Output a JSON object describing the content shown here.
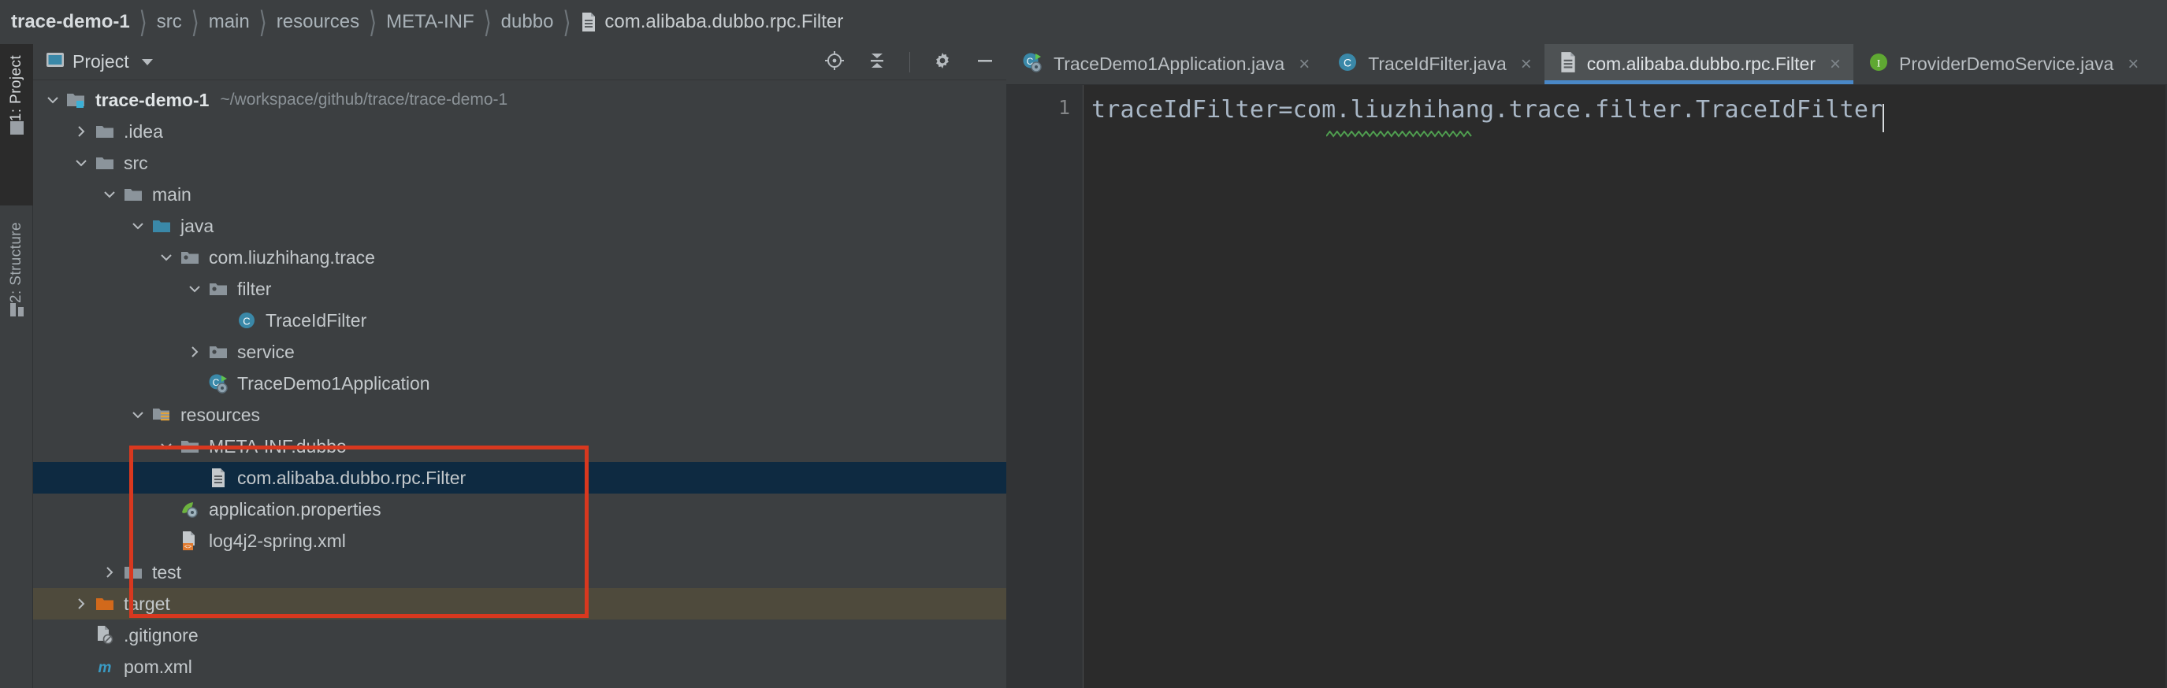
{
  "breadcrumb": {
    "items": [
      {
        "label": "trace-demo-1",
        "kind": "root"
      },
      {
        "label": "src",
        "kind": "plain"
      },
      {
        "label": "main",
        "kind": "plain"
      },
      {
        "label": "resources",
        "kind": "plain"
      },
      {
        "label": "META-INF",
        "kind": "plain"
      },
      {
        "label": "dubbo",
        "kind": "plain"
      },
      {
        "label": "com.alibaba.dubbo.rpc.Filter",
        "kind": "file",
        "icon": "text-file-icon"
      }
    ]
  },
  "tool_strip": {
    "tabs": [
      {
        "label": "1: Project",
        "icon": "project-icon",
        "active": true
      },
      {
        "label": "2: Structure",
        "icon": "structure-icon",
        "active": false
      }
    ]
  },
  "project_panel": {
    "title": "Project",
    "view_selector_icon": "chevron-down-icon",
    "tools": [
      {
        "name": "scroll-from-source-icon",
        "tooltip": "Select Opened File"
      },
      {
        "name": "collapse-all-icon",
        "tooltip": "Collapse All"
      },
      {
        "name": "settings-gear-icon",
        "tooltip": "Settings"
      },
      {
        "name": "hide-panel-icon",
        "tooltip": "Hide"
      }
    ],
    "tree": [
      {
        "label": "trace-demo-1",
        "sub": "~/workspace/github/trace/trace-demo-1",
        "depth": 0,
        "arrow": "down",
        "icon": "module-icon",
        "bold": true,
        "state": "normal"
      },
      {
        "label": ".idea",
        "sub": "",
        "depth": 1,
        "arrow": "right",
        "icon": "folder-icon",
        "bold": false,
        "state": "normal"
      },
      {
        "label": "src",
        "sub": "",
        "depth": 1,
        "arrow": "down",
        "icon": "folder-icon",
        "bold": false,
        "state": "normal"
      },
      {
        "label": "main",
        "sub": "",
        "depth": 2,
        "arrow": "down",
        "icon": "folder-icon",
        "bold": false,
        "state": "normal"
      },
      {
        "label": "java",
        "sub": "",
        "depth": 3,
        "arrow": "down",
        "icon": "source-root-icon",
        "bold": false,
        "state": "normal"
      },
      {
        "label": "com.liuzhihang.trace",
        "sub": "",
        "depth": 4,
        "arrow": "down",
        "icon": "package-icon",
        "bold": false,
        "state": "normal"
      },
      {
        "label": "filter",
        "sub": "",
        "depth": 5,
        "arrow": "down",
        "icon": "package-icon",
        "bold": false,
        "state": "normal"
      },
      {
        "label": "TraceIdFilter",
        "sub": "",
        "depth": 6,
        "arrow": "none",
        "icon": "java-class-icon",
        "bold": false,
        "state": "normal"
      },
      {
        "label": "service",
        "sub": "",
        "depth": 5,
        "arrow": "right",
        "icon": "package-icon",
        "bold": false,
        "state": "normal"
      },
      {
        "label": "TraceDemo1Application",
        "sub": "",
        "depth": 5,
        "arrow": "none",
        "icon": "spring-boot-class-icon",
        "bold": false,
        "state": "normal"
      },
      {
        "label": "resources",
        "sub": "",
        "depth": 3,
        "arrow": "down",
        "icon": "resource-root-icon",
        "bold": false,
        "state": "normal"
      },
      {
        "label": "META-INF.dubbo",
        "sub": "",
        "depth": 4,
        "arrow": "down",
        "icon": "folder-icon",
        "bold": false,
        "state": "normal"
      },
      {
        "label": "com.alibaba.dubbo.rpc.Filter",
        "sub": "",
        "depth": 5,
        "arrow": "none",
        "icon": "text-file-icon",
        "bold": false,
        "state": "selected"
      },
      {
        "label": "application.properties",
        "sub": "",
        "depth": 4,
        "arrow": "none",
        "icon": "spring-properties-icon",
        "bold": false,
        "state": "normal"
      },
      {
        "label": "log4j2-spring.xml",
        "sub": "",
        "depth": 4,
        "arrow": "none",
        "icon": "xml-file-icon",
        "bold": false,
        "state": "normal"
      },
      {
        "label": "test",
        "sub": "",
        "depth": 2,
        "arrow": "right",
        "icon": "folder-icon",
        "bold": false,
        "state": "normal"
      },
      {
        "label": "target",
        "sub": "",
        "depth": 1,
        "arrow": "right",
        "icon": "excluded-folder-icon",
        "bold": false,
        "state": "excluded"
      },
      {
        "label": ".gitignore",
        "sub": "",
        "depth": 1,
        "arrow": "none",
        "icon": "gitignore-file-icon",
        "bold": false,
        "state": "normal"
      },
      {
        "label": "pom.xml",
        "sub": "",
        "depth": 1,
        "arrow": "none",
        "icon": "maven-pom-icon",
        "bold": false,
        "state": "normal"
      }
    ]
  },
  "annotation": {
    "name": "red-highlight-box",
    "color": "#d8381f"
  },
  "editor": {
    "tabs": [
      {
        "label": "TraceDemo1Application.java",
        "icon": "spring-boot-run-icon",
        "active": false,
        "close": "×"
      },
      {
        "label": "TraceIdFilter.java",
        "icon": "java-class-icon",
        "active": false,
        "close": "×"
      },
      {
        "label": "com.alibaba.dubbo.rpc.Filter",
        "icon": "text-file-icon",
        "active": true,
        "close": "×"
      },
      {
        "label": "ProviderDemoService.java",
        "icon": "java-interface-icon",
        "active": false,
        "close": "×"
      }
    ],
    "line_numbers": [
      "1"
    ],
    "content": "traceIdFilter=com.liuzhihang.trace.filter.TraceIdFilter",
    "spellcheck_underline_word": "liuzhihang",
    "caret_after_column": 55
  },
  "colors": {
    "panel_bg": "#3c3f41",
    "editor_bg": "#2b2b2b",
    "gutter_bg": "#313335",
    "selection_bg": "#0e2a41",
    "excluded_row_bg": "#4e4a3c",
    "tab_active_bg": "#4e5254",
    "tab_underline": "#4a88c7",
    "accent_blue": "#3a88a8",
    "annotation_red": "#d8381f",
    "text_primary": "#c3c8cb",
    "code_text": "#a9b7c6"
  }
}
